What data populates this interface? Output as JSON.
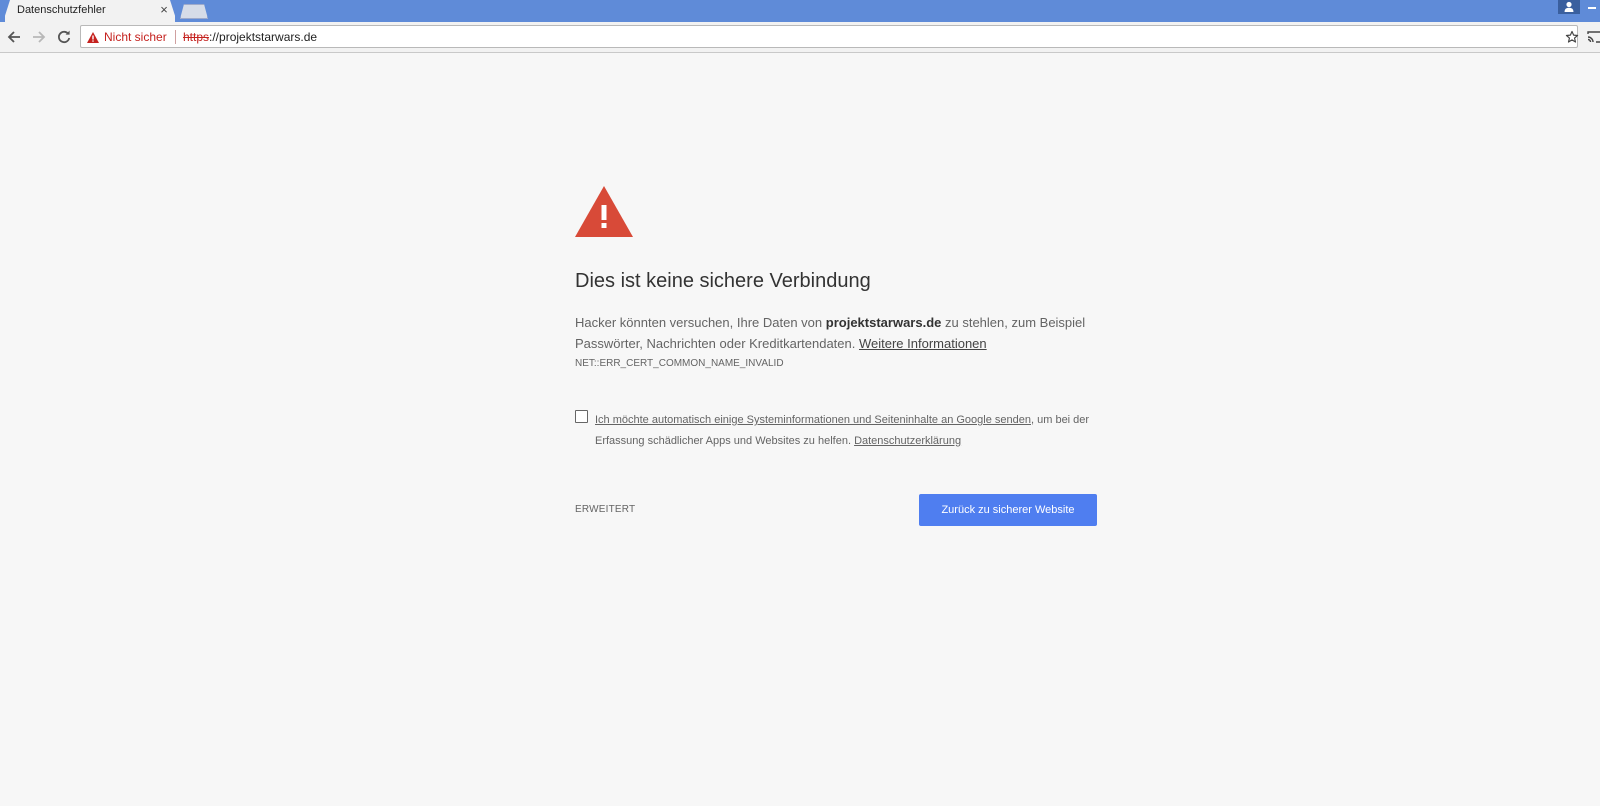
{
  "browser": {
    "tab_title": "Datenschutzfehler",
    "tab_close": "×",
    "security_label": "Nicht sicher",
    "url_scheme": "https",
    "url_rest": "://projektstarwars.de"
  },
  "interstitial": {
    "headline": "Dies ist keine sichere Verbindung",
    "explanation_part1": "Hacker könnten versuchen, Ihre Daten von ",
    "explanation_domain": "projektstarwars.de",
    "explanation_part2": " zu stehlen, zum Beispiel Passwörter, Nachrichten oder Kreditkartendaten. ",
    "learn_more_link": "Weitere Informationen",
    "error_code": "NET::ERR_CERT_COMMON_NAME_INVALID",
    "optin_link": "Ich möchte automatisch einige Systeminformationen und Seiteninhalte an Google senden",
    "optin_text": ", um bei der Erfassung schädlicher Apps und Websites zu helfen. ",
    "privacy_link": "Datenschutzerklärung",
    "optin_checked": false,
    "advanced_button": "ERWEITERT",
    "primary_button": "Zurück zu sicherer Website"
  },
  "colors": {
    "tabstrip": "#5f8bd8",
    "danger": "#c5221f",
    "warning_icon": "#d84a38",
    "primary_button": "#4f7ef0",
    "page_background": "#f7f7f7"
  },
  "icons": [
    "back-arrow-icon",
    "forward-arrow-icon",
    "reload-icon",
    "warning-triangle-icon",
    "star-icon",
    "cast-icon",
    "profile-icon"
  ]
}
